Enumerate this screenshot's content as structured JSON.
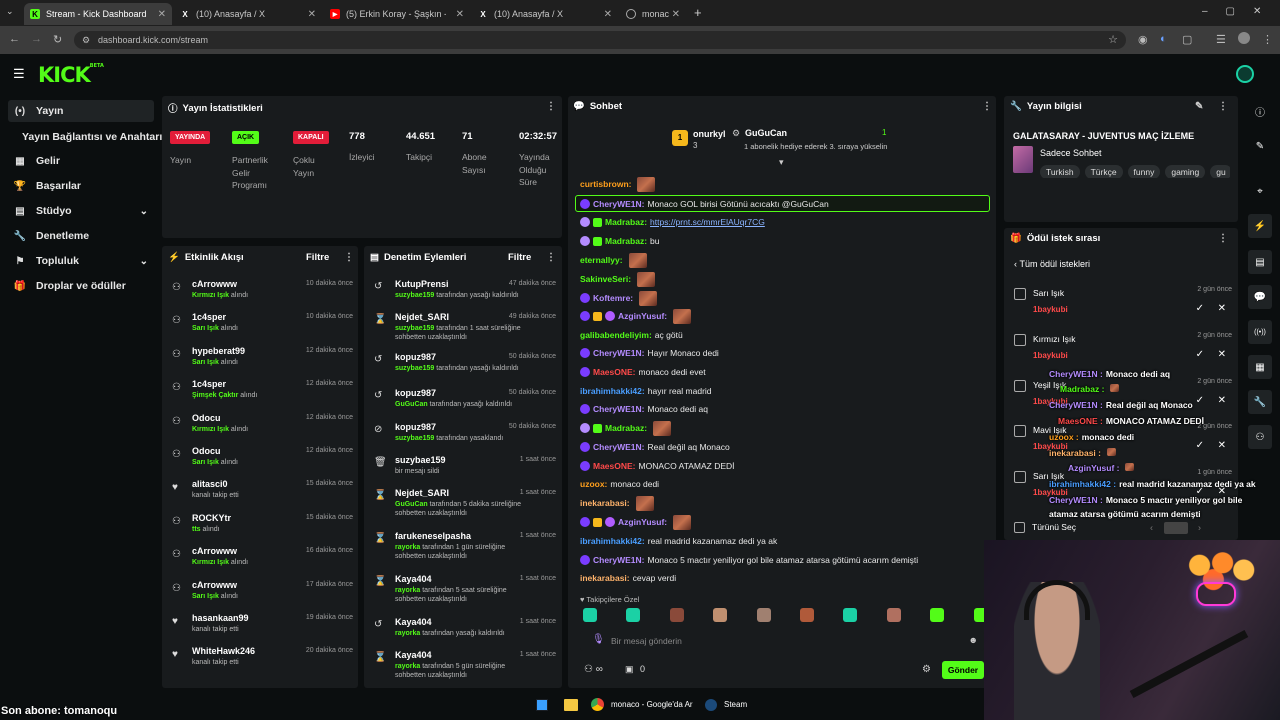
{
  "browser": {
    "tabs": [
      {
        "title": "Stream - Kick Dashboard",
        "icon": "kick-icon",
        "color": "#53fc18"
      },
      {
        "title": "(10) Anasayfa / X",
        "icon": "x-icon",
        "color": "#ffffff"
      },
      {
        "title": "(5) Erkin Koray - Şaşkın - YouTube",
        "icon": "youtube-icon",
        "color": "#ff0000"
      },
      {
        "title": "(10) Anasayfa / X",
        "icon": "x-icon",
        "color": "#ffffff"
      },
      {
        "title": "monac",
        "icon": "globe-icon",
        "color": "#aaaaaa"
      }
    ],
    "url": "dashboard.kick.com/stream"
  },
  "kick": {
    "logo": "KICK",
    "logo_sup": "BETA"
  },
  "sidebar": {
    "items": [
      {
        "label": "Yayın",
        "icon": "stream-icon"
      },
      {
        "label": "Yayın Bağlantısı ve Anahtarı",
        "icon": ""
      },
      {
        "label": "Gelir",
        "icon": "money-icon"
      },
      {
        "label": "Başarılar",
        "icon": "trophy-icon"
      },
      {
        "label": "Stüdyo",
        "icon": "studio-icon"
      },
      {
        "label": "Denetleme",
        "icon": "wrench-icon"
      },
      {
        "label": "Topluluk",
        "icon": "community-icon"
      },
      {
        "label": "Droplar ve ödüller",
        "icon": "gift-icon"
      }
    ]
  },
  "stats": {
    "title": "Yayın İstatistikleri",
    "badges": [
      {
        "badge": "YAYINDA",
        "label": "Yayın",
        "color": "#e21d39"
      },
      {
        "badge": "AÇIK",
        "label": "Partnerlik Gelir Programı",
        "color": "#53fc18"
      },
      {
        "badge": "KAPALI",
        "label": "Çoklu Yayın",
        "color": "#e21d39"
      }
    ],
    "values": [
      {
        "value": "778",
        "label": "İzleyici"
      },
      {
        "value": "44.651",
        "label": "Takipçi"
      },
      {
        "value": "71",
        "label": "Abone Sayısı"
      },
      {
        "value": "02:32:57",
        "label": "Yayında Olduğu Süre"
      }
    ]
  },
  "activity": {
    "title": "Etkinlik Akışı",
    "filter": "Filtre",
    "items": [
      {
        "name": "cArrowww",
        "sub_hl": "Kırmızı Işık",
        "sub": " alındı",
        "time": "10 dakika önce"
      },
      {
        "name": "1c4sper",
        "sub_hl": "Sarı Işık",
        "sub": " alındı",
        "time": "10 dakika önce"
      },
      {
        "name": "hypeberat99",
        "sub_hl": "Sarı Işık",
        "sub": " alındı",
        "time": "12 dakika önce"
      },
      {
        "name": "1c4sper",
        "sub_hl": "Şimşek Çaktır",
        "sub": " alındı",
        "time": "12 dakika önce"
      },
      {
        "name": "Odocu",
        "sub_hl": "Kırmızı Işık",
        "sub": " alındı",
        "time": "12 dakika önce"
      },
      {
        "name": "Odocu",
        "sub_hl": "Sarı Işık",
        "sub": " alındı",
        "time": "12 dakika önce"
      },
      {
        "name": "alitasci0",
        "sub_hl": "",
        "sub": "kanalı takip etti",
        "time": "15 dakika önce"
      },
      {
        "name": "ROCKYtr",
        "sub_hl": "tts",
        "sub": " alındı",
        "time": "15 dakika önce"
      },
      {
        "name": "cArrowww",
        "sub_hl": "Kırmızı Işık",
        "sub": " alındı",
        "time": "16 dakika önce"
      },
      {
        "name": "cArrowww",
        "sub_hl": "Sarı Işık",
        "sub": " alındı",
        "time": "17 dakika önce"
      },
      {
        "name": "hasankaan99",
        "sub_hl": "",
        "sub": "kanalı takip etti",
        "time": "19 dakika önce"
      },
      {
        "name": "WhiteHawk246",
        "sub_hl": "",
        "sub": "kanalı takip etti",
        "time": "20 dakika önce"
      }
    ]
  },
  "mod": {
    "title": "Denetim Eylemleri",
    "filter": "Filtre",
    "items": [
      {
        "name": "KutupPrensi",
        "by": "suzybae159",
        "text": " tarafından yasağı kaldırıldı",
        "time": "47 dakika önce"
      },
      {
        "name": "Nejdet_SARI",
        "by": "suzybae159",
        "text": " tarafından 1 saat süreliğine sohbetten uzaklaştırıldı",
        "time": "49 dakika önce"
      },
      {
        "name": "kopuz987",
        "by": "suzybae159",
        "text": " tarafından yasağı kaldırıldı",
        "time": "50 dakika önce"
      },
      {
        "name": "kopuz987",
        "by": "GuGuCan",
        "text": " tarafından yasağı kaldırıldı",
        "time": "50 dakika önce"
      },
      {
        "name": "kopuz987",
        "by": "suzybae159",
        "text": " tarafından yasaklandı",
        "time": "50 dakika önce"
      },
      {
        "name": "suzybae159",
        "by": "",
        "text": "bir mesajı sildi",
        "time": "1 saat önce"
      },
      {
        "name": "Nejdet_SARI",
        "by": "GuGuCan",
        "text": " tarafından 5 dakika süreliğine sohbetten uzaklaştırıldı",
        "time": "1 saat önce"
      },
      {
        "name": "farukeneselpasha",
        "by": "rayorka",
        "text": " tarafından 1 gün süreliğine sohbetten uzaklaştırıldı",
        "time": "1 saat önce"
      },
      {
        "name": "Kaya404",
        "by": "rayorka",
        "text": " tarafından 5 saat süreliğine sohbetten uzaklaştırıldı",
        "time": "1 saat önce"
      },
      {
        "name": "Kaya404",
        "by": "rayorka",
        "text": " tarafından yasağı kaldırıldı",
        "time": "1 saat önce"
      },
      {
        "name": "Kaya404",
        "by": "rayorka",
        "text": " tarafından 5 gün süreliğine sohbetten uzaklaştırıldı",
        "time": "1 saat önce"
      }
    ]
  },
  "chat": {
    "title": "Sohbet",
    "pinned": {
      "top_user": "onurkyl",
      "top_user_sub": "3",
      "rank": "1",
      "gifter": "GuGuCan",
      "gifter_count": "1",
      "gift_msg": "1 abonelik hediye ederek 3. sıraya yükselin"
    },
    "messages": [
      {
        "user": "curtisbrown:",
        "color": "#ff9f1c",
        "text": "",
        "emote": true
      },
      {
        "user": "CheryWE1N:",
        "color": "#b48cff",
        "text": "Monaco GOL birisi Götünü acıcaktı @GuGuCan",
        "highlight": true
      },
      {
        "user": "Madrabaz:",
        "color": "#53fc18",
        "text": "",
        "link": "https://prnt.sc/mmrElAUqr7CG"
      },
      {
        "user": "Madrabaz:",
        "color": "#53fc18",
        "text": "bu"
      },
      {
        "user": "eternallyy:",
        "color": "#53fc18",
        "text": "",
        "emote": true
      },
      {
        "user": "SakinveSeri:",
        "color": "#53fc18",
        "text": "",
        "emote": true
      },
      {
        "user": "Koftemre:",
        "color": "#b48cff",
        "text": "",
        "emote": true
      },
      {
        "user": "AzginYusuf:",
        "color": "#b48cff",
        "text": "",
        "emote": true
      },
      {
        "user": "galibabendeliyim:",
        "color": "#53fc18",
        "text": "aç götü"
      },
      {
        "user": "CheryWE1N:",
        "color": "#b48cff",
        "text": "Hayır Monaco dedi"
      },
      {
        "user": "MaesONE:",
        "color": "#ff4a4a",
        "text": "monaco dedi evet"
      },
      {
        "user": "ibrahimhakki42:",
        "color": "#4a9eff",
        "text": "hayır real madrid"
      },
      {
        "user": "CheryWE1N:",
        "color": "#b48cff",
        "text": "Monaco dedi aq"
      },
      {
        "user": "Madrabaz:",
        "color": "#53fc18",
        "text": "",
        "emote": true
      },
      {
        "user": "CheryWE1N:",
        "color": "#b48cff",
        "text": "Real değil aq Monaco"
      },
      {
        "user": "MaesONE:",
        "color": "#ff4a4a",
        "text": "MONACO ATAMAZ DEDİ"
      },
      {
        "user": "uzoox:",
        "color": "#ff9f1c",
        "text": "monaco dedi"
      },
      {
        "user": "inekarabasi:",
        "color": "#ffb36b",
        "text": "",
        "emote": true
      },
      {
        "user": "AzginYusuf:",
        "color": "#b48cff",
        "text": "",
        "emote": true
      },
      {
        "user": "ibrahimhakki42:",
        "color": "#4a9eff",
        "text": "real madrid kazanamaz dedi ya ak"
      },
      {
        "user": "CheryWE1N:",
        "color": "#b48cff",
        "text": "Monaco 5 mactır yeniliyor gol bile atamaz atarsa götümü acarım demişti"
      },
      {
        "user": "inekarabasi:",
        "color": "#ffb36b",
        "text": "cevap verdi"
      }
    ],
    "followers_only": "Takipçilere Özel",
    "input_placeholder": "Bir mesaj gönderin",
    "points_label": "∞",
    "gift_count": "0",
    "send": "Gönder"
  },
  "stream_info": {
    "title": "Yayın bilgisi",
    "stream_title": "GALATASARAY - JUVENTUS MAÇ İZLEME",
    "category": "Sadece Sohbet",
    "tags": [
      "Turkish",
      "Türkçe",
      "funny",
      "gaming",
      "gu"
    ]
  },
  "rewards": {
    "title": "Ödül istek sırası",
    "back": "Tüm ödül istekleri",
    "items": [
      {
        "name": "Sarı Işık",
        "user": "1baykubi",
        "time": "2 gün önce"
      },
      {
        "name": "Kırmızı Işık",
        "user": "1baykubi",
        "time": "2 gün önce"
      },
      {
        "name": "Yeşil Işık",
        "user": "1baykubi",
        "time": "2 gün önce"
      },
      {
        "name": "Mavi Işık",
        "user": "1baykubi",
        "time": "2 gün önce"
      },
      {
        "name": "Sarı Işık",
        "user": "1baykubi",
        "time": "1 gün önce"
      }
    ],
    "select_all": "Türünü Seç"
  },
  "overlay_chat": [
    {
      "user": "CheryWE1N :",
      "text": "Monaco dedi aq",
      "color": "#b48cff"
    },
    {
      "user": "Madrabaz :",
      "text": "",
      "color": "#53fc18"
    },
    {
      "user": "CheryWE1N :",
      "text": "Real değil aq Monaco",
      "color": "#b48cff"
    },
    {
      "user": "MaesONE :",
      "text": "MONACO ATAMAZ DEDİ",
      "color": "#ff4a4a"
    },
    {
      "user": "uzoox :",
      "text": "monaco dedi",
      "color": "#ff9f1c"
    },
    {
      "user": "inekarabasi :",
      "text": "",
      "color": "#ffb36b"
    },
    {
      "user": "AzginYusuf :",
      "text": "",
      "color": "#b48cff"
    },
    {
      "user": "ibrahimhakki42 :",
      "text": "real madrid kazanamaz dedi ya ak",
      "color": "#4a9eff"
    },
    {
      "user": "CheryWE1N :",
      "text": "Monaco 5 mactır yeniliyor gol bile",
      "color": "#b48cff"
    },
    {
      "user": "",
      "text": "atamaz atarsa götümü acarım demişti",
      "color": "#ffffff"
    }
  ],
  "ticker": "Son abone: tomanoqu",
  "taskbar": {
    "chrome_label": "monaco - Google'da Ar",
    "steam_label": "Steam"
  }
}
